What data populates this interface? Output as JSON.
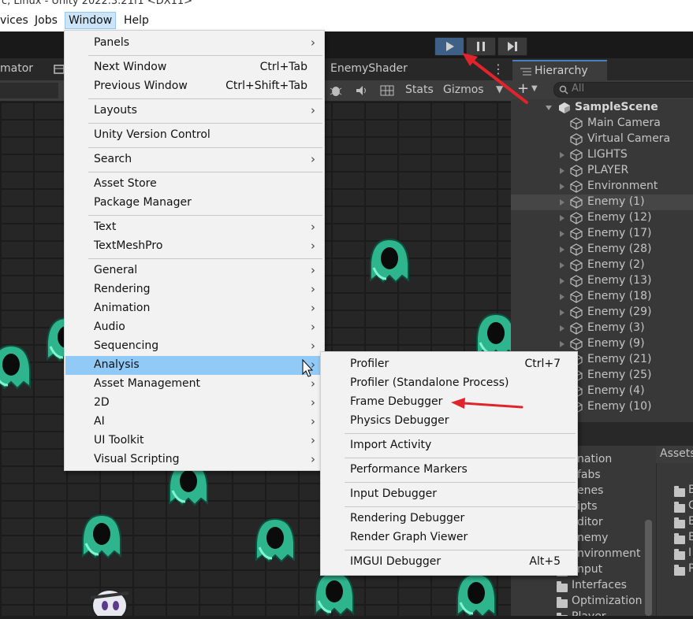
{
  "title_bar": {
    "text": "c, Linux - Unity 2022.3.21f1 <DX11>"
  },
  "menu_bar": {
    "items": [
      {
        "label": "vices"
      },
      {
        "label": "Jobs"
      },
      {
        "label": "Window"
      },
      {
        "label": "Help"
      }
    ]
  },
  "toolbar": {
    "play_icon": "play-icon",
    "pause_icon": "pause-icon",
    "step_icon": "step-icon"
  },
  "scene_panel": {
    "tab_left": "mator",
    "tab_shader": "EnemyShader",
    "tools": {
      "stats": "Stats",
      "gizmos": "Gizmos"
    }
  },
  "window_menu": {
    "groups": [
      [
        {
          "label": "Panels",
          "submenu": true
        }
      ],
      [
        {
          "label": "Next Window",
          "shortcut": "Ctrl+Tab"
        },
        {
          "label": "Previous Window",
          "shortcut": "Ctrl+Shift+Tab"
        }
      ],
      [
        {
          "label": "Layouts",
          "submenu": true
        }
      ],
      [
        {
          "label": "Unity Version Control"
        }
      ],
      [
        {
          "label": "Search",
          "submenu": true
        }
      ],
      [
        {
          "label": "Asset Store"
        },
        {
          "label": "Package Manager"
        }
      ],
      [
        {
          "label": "Text",
          "submenu": true
        },
        {
          "label": "TextMeshPro",
          "submenu": true
        }
      ],
      [
        {
          "label": "General",
          "submenu": true
        },
        {
          "label": "Rendering",
          "submenu": true
        },
        {
          "label": "Animation",
          "submenu": true
        },
        {
          "label": "Audio",
          "submenu": true
        },
        {
          "label": "Sequencing",
          "submenu": true
        },
        {
          "label": "Analysis",
          "submenu": true,
          "highlighted": true
        },
        {
          "label": "Asset Management",
          "submenu": true
        },
        {
          "label": "2D",
          "submenu": true
        },
        {
          "label": "AI",
          "submenu": true
        },
        {
          "label": "UI Toolkit",
          "submenu": true
        },
        {
          "label": "Visual Scripting",
          "submenu": true
        }
      ]
    ]
  },
  "analysis_submenu": {
    "groups": [
      [
        {
          "label": "Profiler",
          "shortcut": "Ctrl+7"
        },
        {
          "label": "Profiler (Standalone Process)"
        },
        {
          "label": "Frame Debugger"
        },
        {
          "label": "Physics Debugger"
        }
      ],
      [
        {
          "label": "Import Activity"
        }
      ],
      [
        {
          "label": "Performance Markers"
        }
      ],
      [
        {
          "label": "Input Debugger"
        }
      ],
      [
        {
          "label": "Rendering Debugger"
        },
        {
          "label": "Render Graph Viewer"
        }
      ],
      [
        {
          "label": "IMGUI Debugger",
          "shortcut": "Alt+5"
        }
      ]
    ]
  },
  "hierarchy": {
    "tab_label": "Hierarchy",
    "search_placeholder": "All",
    "scene_name": "SampleScene",
    "rows": [
      {
        "label": "Main Camera",
        "expandable": false
      },
      {
        "label": "Virtual Camera",
        "expandable": false
      },
      {
        "label": "LIGHTS",
        "expandable": true
      },
      {
        "label": "PLAYER",
        "expandable": true
      },
      {
        "label": "Environment",
        "expandable": true
      },
      {
        "label": "Enemy (1)",
        "expandable": true,
        "selected": true
      },
      {
        "label": "Enemy (12)",
        "expandable": true
      },
      {
        "label": "Enemy (17)",
        "expandable": true
      },
      {
        "label": "Enemy (28)",
        "expandable": true
      },
      {
        "label": "Enemy (2)",
        "expandable": true
      },
      {
        "label": "Enemy (13)",
        "expandable": true
      },
      {
        "label": "Enemy (18)",
        "expandable": true
      },
      {
        "label": "Enemy (29)",
        "expandable": true
      },
      {
        "label": "Enemy (3)",
        "expandable": true
      },
      {
        "label": "Enemy (9)",
        "expandable": true
      },
      {
        "label": "Enemy (21)",
        "expandable": true
      },
      {
        "label": "Enemy (25)",
        "expandable": true
      },
      {
        "label": "Enemy (4)",
        "expandable": true
      },
      {
        "label": "Enemy (10)",
        "expandable": true
      }
    ]
  },
  "project": {
    "folders": [
      "nation",
      "fabs",
      "enes",
      "ipts",
      "ditor",
      "nemy",
      "nvironment",
      "nput",
      "Interfaces",
      "Optimization",
      "Player"
    ],
    "assets_label": "Assets",
    "asset_letters": [
      "B",
      "C",
      "E",
      "E",
      "I",
      "P"
    ]
  },
  "annotation_color": "#e0242c"
}
